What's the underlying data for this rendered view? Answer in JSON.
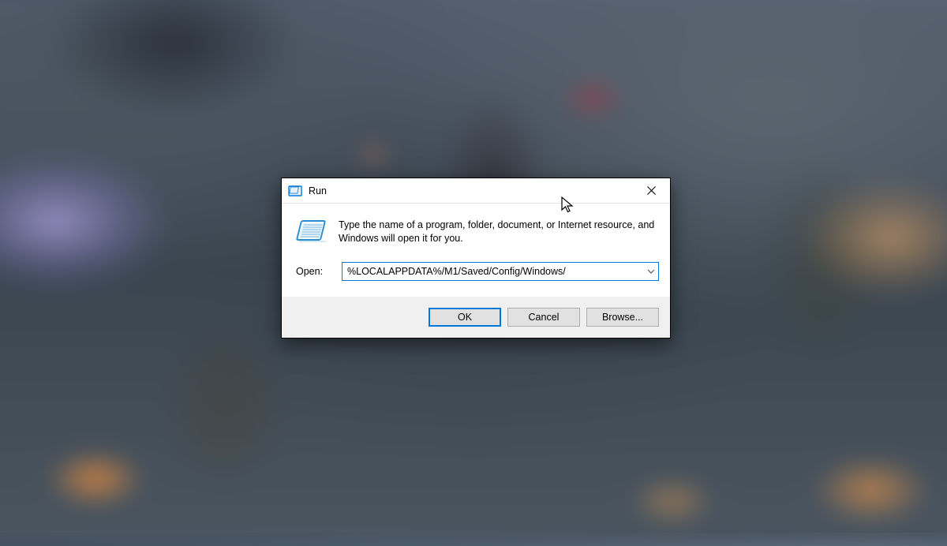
{
  "dialog": {
    "title": "Run",
    "description": "Type the name of a program, folder, document, or Internet resource, and Windows will open it for you.",
    "open_label": "Open:",
    "input_value": "%LOCALAPPDATA%/M1/Saved/Config/Windows/",
    "buttons": {
      "ok": "OK",
      "cancel": "Cancel",
      "browse": "Browse..."
    }
  }
}
